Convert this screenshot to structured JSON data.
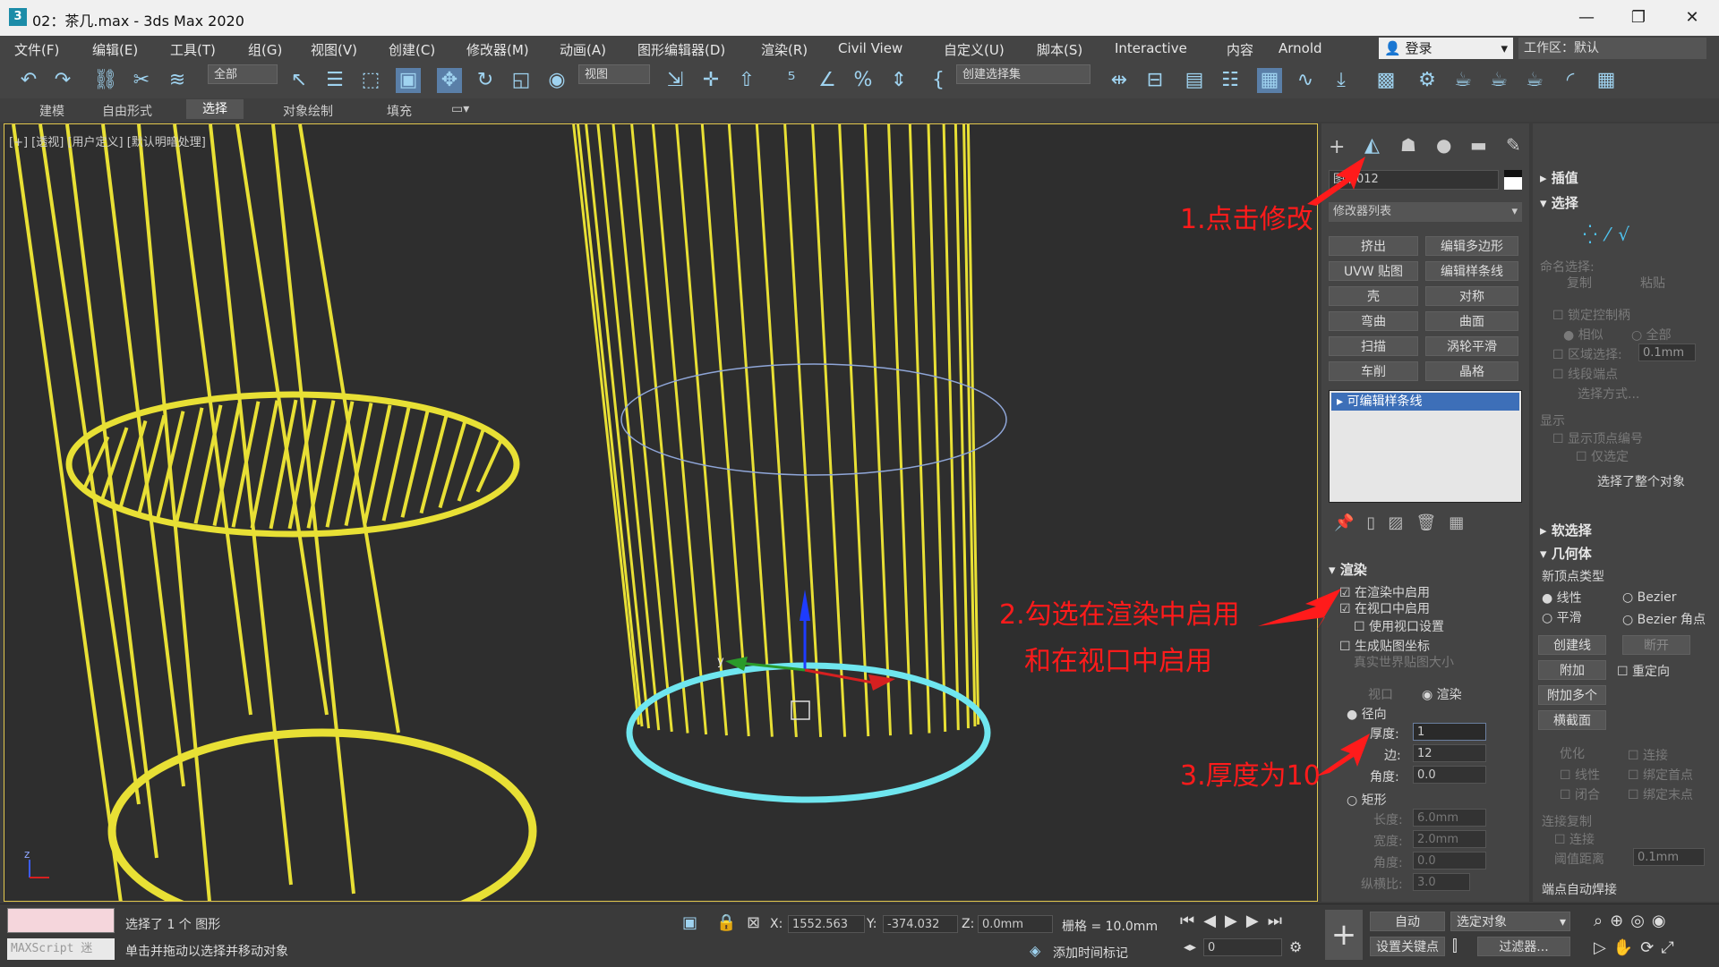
{
  "window": {
    "title": "02：茶几.max - 3ds Max 2020",
    "app_icon": "3",
    "controls": [
      "—",
      "❐",
      "✕"
    ]
  },
  "menu": [
    "文件(F)",
    "编辑(E)",
    "工具(T)",
    "组(G)",
    "视图(V)",
    "创建(C)",
    "修改器(M)",
    "动画(A)",
    "图形编辑器(D)",
    "渲染(R)",
    "Civil View",
    "自定义(U)",
    "脚本(S)",
    "Interactive",
    "内容",
    "Arnold"
  ],
  "login": "登录",
  "workspace": "工作区：默认",
  "toolbar": {
    "filter_dropdown": "全部",
    "view_dropdown": "视图",
    "selection_set_dropdown": "创建选择集"
  },
  "ribbon_tabs": [
    "建模",
    "自由形式",
    "选择",
    "对象绘制",
    "填充"
  ],
  "ribbon_active": "选择",
  "viewport": {
    "label": "[+] [透视] [用户定义] [默认明暗处理]"
  },
  "command_panel": {
    "object_name": "图形012",
    "modifier_list": "修改器列表",
    "modifier_buttons": [
      "挤出",
      "编辑多边形",
      "UVW 贴图",
      "编辑样条线",
      "壳",
      "对称",
      "弯曲",
      "曲面",
      "扫描",
      "涡轮平滑",
      "车削",
      "晶格"
    ],
    "stack_item": "可编辑样条线",
    "render_header": "渲染",
    "enable_in_render": "在渲染中启用",
    "enable_in_viewport": "在视口中启用",
    "use_viewport_settings": "使用视口设置",
    "gen_mapping": "生成贴图坐标",
    "real_world": "真实世界贴图大小",
    "viewport_radio": "视口",
    "render_radio": "渲染",
    "radial": "径向",
    "thickness_label": "厚度:",
    "thickness_value": "1",
    "sides_label": "边:",
    "sides_value": "12",
    "angle_label": "角度:",
    "angle_value": "0.0",
    "rectangular": "矩形",
    "length_label": "长度:",
    "length_value": "6.0mm",
    "width_label": "宽度:",
    "width_value": "2.0mm",
    "rect_angle_label": "角度:",
    "rect_angle_value": "0.0",
    "aspect_label": "纵横比:",
    "aspect_value": "3.0"
  },
  "rollout_right": {
    "interpolation": "插值",
    "selection": "选择",
    "named_selection": "命名选择:",
    "copy": "复制",
    "paste": "粘贴",
    "lock_handles": "锁定控制柄",
    "alike": "相似",
    "all": "全部",
    "area_selection": "区域选择:",
    "area_value": "0.1mm",
    "segment_end": "线段端点",
    "select_by": "选择方式...",
    "display": "显示",
    "show_vertex_numbers": "显示顶点编号",
    "selected_only": "仅选定",
    "selected_whole": "选择了整个对象",
    "soft_selection": "软选择",
    "geometry": "几何体",
    "new_vertex_type": "新顶点类型",
    "linear": "线性",
    "bezier": "Bezier",
    "smooth": "平滑",
    "bezier_corner": "Bezier 角点",
    "create_line": "创建线",
    "break": "断开",
    "attach": "附加",
    "reorient": "重定向",
    "attach_mult": "附加多个",
    "cross_section": "横截面",
    "refine": "优化",
    "connect": "连接",
    "linear2": "线性",
    "bind_first": "绑定首点",
    "closed": "闭合",
    "bind_last": "绑定末点",
    "connect_copy": "连接复制",
    "connect2": "连接",
    "threshold": "阈值距离",
    "threshold_value": "0.1mm",
    "auto_weld": "端点自动焊接"
  },
  "annotations": {
    "step1": "1.点击修改",
    "step2a": "2.勾选在渲染中启用",
    "step2b": "和在视口中启用",
    "step3": "3.厚度为10"
  },
  "status": {
    "maxscript": "MAXScript 迷",
    "selected": "选择了 1 个 图形",
    "hint": "单击并拖动以选择并移动对象",
    "x_label": "X:",
    "x_value": "1552.563",
    "y_label": "Y:",
    "y_value": "-374.032",
    "z_label": "Z:",
    "z_value": "0.0mm",
    "grid": "栅格 = 10.0mm",
    "add_time_tag": "添加时间标记",
    "auto": "自动",
    "selected_object": "选定对象",
    "set_key": "设置关键点",
    "filters": "过滤器...",
    "frame": "0"
  },
  "colors": {
    "wire": "#e8e035",
    "selected": "#6fe6ef",
    "annotation": "#ff1b1b",
    "stack_highlight": "#3d6fb8"
  }
}
